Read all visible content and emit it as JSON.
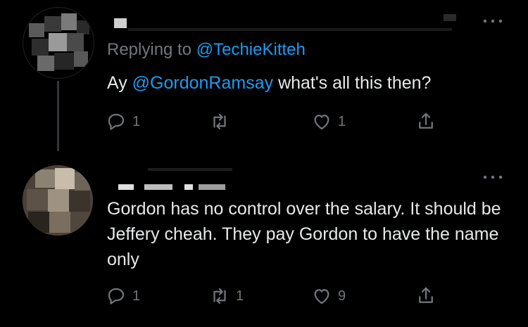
{
  "tweets": [
    {
      "reply_prefix": "Replying to ",
      "reply_handle": "@TechieKitteh",
      "text_before": "Ay ",
      "mention": "@GordonRamsay",
      "text_after": " what's all this then?",
      "actions": {
        "reply_count": "1",
        "retweet_count": "",
        "like_count": "1"
      }
    },
    {
      "body": "Gordon has no control over the salary. It should be Jeffery cheah. They pay Gordon to have the name only",
      "actions": {
        "reply_count": "1",
        "retweet_count": "1",
        "like_count": "9"
      }
    }
  ],
  "icons": [
    "reply-icon",
    "retweet-icon",
    "like-icon",
    "share-icon",
    "more-icon"
  ],
  "colors": {
    "background": "#000000",
    "text": "#e7e9ea",
    "muted": "#71767b",
    "link": "#1d9bf0"
  }
}
